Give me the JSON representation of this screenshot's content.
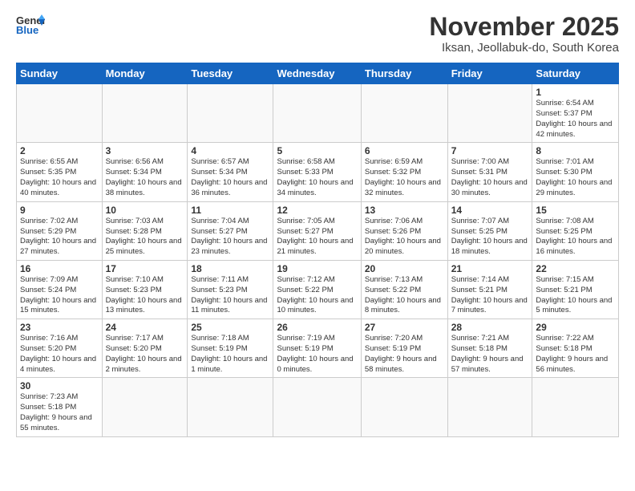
{
  "header": {
    "logo_general": "General",
    "logo_blue": "Blue",
    "month_title": "November 2025",
    "location": "Iksan, Jeollabuk-do, South Korea"
  },
  "weekdays": [
    "Sunday",
    "Monday",
    "Tuesday",
    "Wednesday",
    "Thursday",
    "Friday",
    "Saturday"
  ],
  "weeks": [
    [
      {
        "day": "",
        "info": ""
      },
      {
        "day": "",
        "info": ""
      },
      {
        "day": "",
        "info": ""
      },
      {
        "day": "",
        "info": ""
      },
      {
        "day": "",
        "info": ""
      },
      {
        "day": "",
        "info": ""
      },
      {
        "day": "1",
        "info": "Sunrise: 6:54 AM\nSunset: 5:37 PM\nDaylight: 10 hours\nand 42 minutes."
      }
    ],
    [
      {
        "day": "2",
        "info": "Sunrise: 6:55 AM\nSunset: 5:35 PM\nDaylight: 10 hours\nand 40 minutes."
      },
      {
        "day": "3",
        "info": "Sunrise: 6:56 AM\nSunset: 5:34 PM\nDaylight: 10 hours\nand 38 minutes."
      },
      {
        "day": "4",
        "info": "Sunrise: 6:57 AM\nSunset: 5:34 PM\nDaylight: 10 hours\nand 36 minutes."
      },
      {
        "day": "5",
        "info": "Sunrise: 6:58 AM\nSunset: 5:33 PM\nDaylight: 10 hours\nand 34 minutes."
      },
      {
        "day": "6",
        "info": "Sunrise: 6:59 AM\nSunset: 5:32 PM\nDaylight: 10 hours\nand 32 minutes."
      },
      {
        "day": "7",
        "info": "Sunrise: 7:00 AM\nSunset: 5:31 PM\nDaylight: 10 hours\nand 30 minutes."
      },
      {
        "day": "8",
        "info": "Sunrise: 7:01 AM\nSunset: 5:30 PM\nDaylight: 10 hours\nand 29 minutes."
      }
    ],
    [
      {
        "day": "9",
        "info": "Sunrise: 7:02 AM\nSunset: 5:29 PM\nDaylight: 10 hours\nand 27 minutes."
      },
      {
        "day": "10",
        "info": "Sunrise: 7:03 AM\nSunset: 5:28 PM\nDaylight: 10 hours\nand 25 minutes."
      },
      {
        "day": "11",
        "info": "Sunrise: 7:04 AM\nSunset: 5:27 PM\nDaylight: 10 hours\nand 23 minutes."
      },
      {
        "day": "12",
        "info": "Sunrise: 7:05 AM\nSunset: 5:27 PM\nDaylight: 10 hours\nand 21 minutes."
      },
      {
        "day": "13",
        "info": "Sunrise: 7:06 AM\nSunset: 5:26 PM\nDaylight: 10 hours\nand 20 minutes."
      },
      {
        "day": "14",
        "info": "Sunrise: 7:07 AM\nSunset: 5:25 PM\nDaylight: 10 hours\nand 18 minutes."
      },
      {
        "day": "15",
        "info": "Sunrise: 7:08 AM\nSunset: 5:25 PM\nDaylight: 10 hours\nand 16 minutes."
      }
    ],
    [
      {
        "day": "16",
        "info": "Sunrise: 7:09 AM\nSunset: 5:24 PM\nDaylight: 10 hours\nand 15 minutes."
      },
      {
        "day": "17",
        "info": "Sunrise: 7:10 AM\nSunset: 5:23 PM\nDaylight: 10 hours\nand 13 minutes."
      },
      {
        "day": "18",
        "info": "Sunrise: 7:11 AM\nSunset: 5:23 PM\nDaylight: 10 hours\nand 11 minutes."
      },
      {
        "day": "19",
        "info": "Sunrise: 7:12 AM\nSunset: 5:22 PM\nDaylight: 10 hours\nand 10 minutes."
      },
      {
        "day": "20",
        "info": "Sunrise: 7:13 AM\nSunset: 5:22 PM\nDaylight: 10 hours\nand 8 minutes."
      },
      {
        "day": "21",
        "info": "Sunrise: 7:14 AM\nSunset: 5:21 PM\nDaylight: 10 hours\nand 7 minutes."
      },
      {
        "day": "22",
        "info": "Sunrise: 7:15 AM\nSunset: 5:21 PM\nDaylight: 10 hours\nand 5 minutes."
      }
    ],
    [
      {
        "day": "23",
        "info": "Sunrise: 7:16 AM\nSunset: 5:20 PM\nDaylight: 10 hours\nand 4 minutes."
      },
      {
        "day": "24",
        "info": "Sunrise: 7:17 AM\nSunset: 5:20 PM\nDaylight: 10 hours\nand 2 minutes."
      },
      {
        "day": "25",
        "info": "Sunrise: 7:18 AM\nSunset: 5:19 PM\nDaylight: 10 hours\nand 1 minute."
      },
      {
        "day": "26",
        "info": "Sunrise: 7:19 AM\nSunset: 5:19 PM\nDaylight: 10 hours\nand 0 minutes."
      },
      {
        "day": "27",
        "info": "Sunrise: 7:20 AM\nSunset: 5:19 PM\nDaylight: 9 hours\nand 58 minutes."
      },
      {
        "day": "28",
        "info": "Sunrise: 7:21 AM\nSunset: 5:18 PM\nDaylight: 9 hours\nand 57 minutes."
      },
      {
        "day": "29",
        "info": "Sunrise: 7:22 AM\nSunset: 5:18 PM\nDaylight: 9 hours\nand 56 minutes."
      }
    ],
    [
      {
        "day": "30",
        "info": "Sunrise: 7:23 AM\nSunset: 5:18 PM\nDaylight: 9 hours\nand 55 minutes."
      },
      {
        "day": "",
        "info": ""
      },
      {
        "day": "",
        "info": ""
      },
      {
        "day": "",
        "info": ""
      },
      {
        "day": "",
        "info": ""
      },
      {
        "day": "",
        "info": ""
      },
      {
        "day": "",
        "info": ""
      }
    ]
  ]
}
